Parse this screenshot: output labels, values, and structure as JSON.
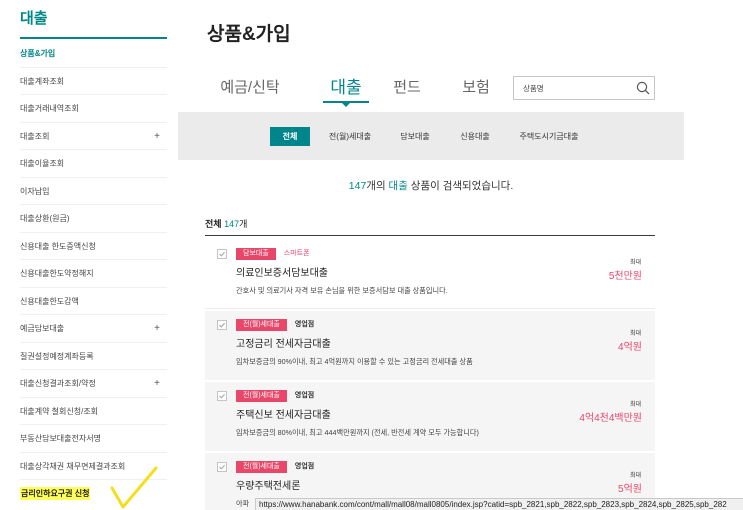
{
  "sidebar": {
    "title": "대출",
    "expand_symbol": "+",
    "items": [
      {
        "label": "상품&가입",
        "active": true
      },
      {
        "label": "대출계좌조회"
      },
      {
        "label": "대출거래내역조회"
      },
      {
        "label": "대출조회",
        "expandable": true
      },
      {
        "label": "대출이율조회"
      },
      {
        "label": "이자납입"
      },
      {
        "label": "대출상환(원금)"
      },
      {
        "label": "신용대출 한도증액신청"
      },
      {
        "label": "신용대출한도약정해지"
      },
      {
        "label": "신용대출한도감액"
      },
      {
        "label": "예금담보대출",
        "expandable": true
      },
      {
        "label": "질권설정예정계좌등록"
      },
      {
        "label": "대출신청결과조회/약정",
        "expandable": true
      },
      {
        "label": "대출계약 철회신청/조회"
      },
      {
        "label": "부동산담보대출전자서명"
      },
      {
        "label": "대출상각채권 채무면제결과조회"
      },
      {
        "label": "금리인하요구권 신청",
        "highlighted": true
      }
    ]
  },
  "annotation": {
    "icon": "check-mark-icon"
  },
  "main": {
    "page_title": "상품&가입",
    "category_tabs": [
      {
        "label": "예금/신탁",
        "active": false
      },
      {
        "label": "대출",
        "active": true
      },
      {
        "label": "펀드",
        "active": false
      },
      {
        "label": "보험",
        "active": false
      }
    ],
    "search": {
      "placeholder": "상품명",
      "icon": "search-icon"
    },
    "sub_tabs": [
      {
        "label": "전체",
        "active": true
      },
      {
        "label": "전(월)세대출",
        "active": false
      },
      {
        "label": "담보대출",
        "active": false
      },
      {
        "label": "신용대출",
        "active": false
      },
      {
        "label": "주택도시기금대출",
        "active": false
      }
    ],
    "result_summary": {
      "count": "147",
      "count_text": "개의",
      "category": "대출",
      "tail": "상품이 검색되었습니다."
    },
    "list_header": {
      "label": "전체",
      "count": "147",
      "unit": "개"
    },
    "products": [
      {
        "badge": "담보대출",
        "channel": "스마트폰",
        "title": "의료인보증서담보대출",
        "description": "간호사 및 의료기사 자격 보유 손님을 위한 보증서담보 대출 상품입니다.",
        "limit_label": "최대",
        "limit_amount": "5천만원"
      },
      {
        "badge": "전(월)세대출",
        "channel": "영업점",
        "title": "고정금리 전세자금대출",
        "description": "임차보증금의 90%이내, 최고 4억원까지 이용할 수 있는 고정금리 전세대출 상품",
        "limit_label": "최대",
        "limit_amount": "4억원"
      },
      {
        "badge": "전(월)세대출",
        "channel": "영업점",
        "title": "주택신보 전세자금대출",
        "description": "임차보증금의 80%이내, 최고 444백만원까지 (전세, 반전세 계약 모두 가능합니다)",
        "limit_label": "최대",
        "limit_amount": "4억4천4백만원"
      },
      {
        "badge": "전(월)세대출",
        "channel": "영업점",
        "title": "우량주택전세론",
        "description": "아파",
        "limit_label": "최대",
        "limit_amount": "5억원"
      }
    ]
  },
  "status_bar": {
    "url": "https://www.hanabank.com/cont/mall/mall08/mall0805/index.jsp?catid=spb_2821,spb_2822,spb_2823,spb_2824,spb_2825,spb_282"
  },
  "colors": {
    "brand_teal": "#00858a",
    "accent_red": "#e8476a",
    "highlight_yellow": "#ffff5a",
    "annotation_yellow": "#f3df1b",
    "panel_gray": "#ebebeb"
  }
}
